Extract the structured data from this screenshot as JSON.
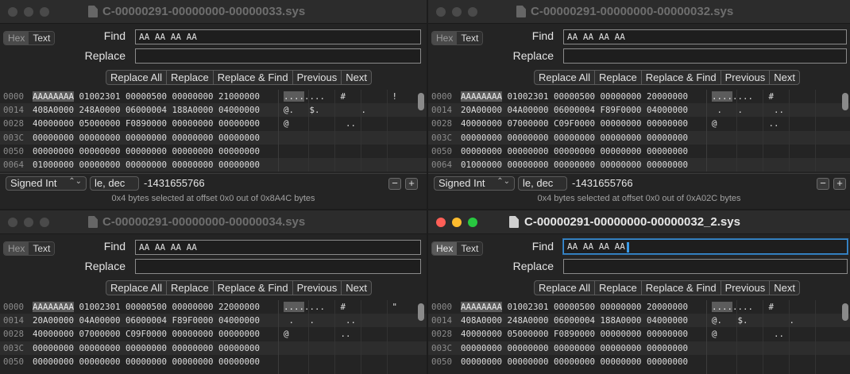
{
  "windows": [
    {
      "title": "C-00000291-00000000-00000033.sys",
      "active": false,
      "hex_label": "Hex",
      "text_label": "Text",
      "find_label": "Find",
      "replace_label": "Replace",
      "find_value": "AA AA AA AA",
      "replace_value": "",
      "buttons": [
        "Replace All",
        "Replace",
        "Replace & Find",
        "Previous",
        "Next"
      ],
      "rows": [
        {
          "offset": "0000",
          "hl": "AAAAAAAA",
          "hex": " 01002301 00000500 00000000 21000000",
          "ascii": "....   #         !"
        },
        {
          "offset": "0014",
          "hl": "",
          "hex": "408A0000 248A0000 06000004 188A0000 04000000",
          "ascii": "@.   $.        ."
        },
        {
          "offset": "0028",
          "hl": "",
          "hex": "40000000 05000000 F0890000 00000000 00000000",
          "ascii": "@           .."
        },
        {
          "offset": "003C",
          "hl": "",
          "hex": "00000000 00000000 00000000 00000000 00000000",
          "ascii": ""
        },
        {
          "offset": "0050",
          "hl": "",
          "hex": "00000000 00000000 00000000 00000000 00000000",
          "ascii": ""
        },
        {
          "offset": "0064",
          "hl": "",
          "hex": "01000000 00000000 00000000 00000000 00000000",
          "ascii": ""
        }
      ],
      "int_type": "Signed Int",
      "endian": "le, dec",
      "value": "-1431655766",
      "status": "0x4 bytes selected at offset 0x0 out of 0x8A4C bytes"
    },
    {
      "title": "C-00000291-00000000-00000032.sys",
      "active": false,
      "hex_label": "Hex",
      "text_label": "Text",
      "find_label": "Find",
      "replace_label": "Replace",
      "find_value": "AA AA AA AA",
      "replace_value": "",
      "buttons": [
        "Replace All",
        "Replace",
        "Replace & Find",
        "Previous",
        "Next"
      ],
      "rows": [
        {
          "offset": "0000",
          "hl": "AAAAAAAA",
          "hex": " 01002301 00000500 00000000 20000000",
          "ascii": "....   #"
        },
        {
          "offset": "0014",
          "hl": "",
          "hex": "20A00000 04A00000 06000004 F89F0000 04000000",
          "ascii": " .   .      .."
        },
        {
          "offset": "0028",
          "hl": "",
          "hex": "40000000 07000000 C09F0000 00000000 00000000",
          "ascii": "@          .."
        },
        {
          "offset": "003C",
          "hl": "",
          "hex": "00000000 00000000 00000000 00000000 00000000",
          "ascii": ""
        },
        {
          "offset": "0050",
          "hl": "",
          "hex": "00000000 00000000 00000000 00000000 00000000",
          "ascii": ""
        },
        {
          "offset": "0064",
          "hl": "",
          "hex": "01000000 00000000 00000000 00000000 00000000",
          "ascii": ""
        }
      ],
      "int_type": "Signed Int",
      "endian": "le, dec",
      "value": "-1431655766",
      "status": "0x4 bytes selected at offset 0x0 out of 0xA02C bytes"
    },
    {
      "title": "C-00000291-00000000-00000034.sys",
      "active": false,
      "hex_label": "Hex",
      "text_label": "Text",
      "find_label": "Find",
      "replace_label": "Replace",
      "find_value": "AA AA AA AA",
      "replace_value": "",
      "buttons": [
        "Replace All",
        "Replace",
        "Replace & Find",
        "Previous",
        "Next"
      ],
      "rows": [
        {
          "offset": "0000",
          "hl": "AAAAAAAA",
          "hex": " 01002301 00000500 00000000 22000000",
          "ascii": "....   #         \""
        },
        {
          "offset": "0014",
          "hl": "",
          "hex": "20A00000 04A00000 06000004 F89F0000 04000000",
          "ascii": " .   .      .."
        },
        {
          "offset": "0028",
          "hl": "",
          "hex": "40000000 07000000 C09F0000 00000000 00000000",
          "ascii": "@          .."
        },
        {
          "offset": "003C",
          "hl": "",
          "hex": "00000000 00000000 00000000 00000000 00000000",
          "ascii": ""
        },
        {
          "offset": "0050",
          "hl": "",
          "hex": "00000000 00000000 00000000 00000000 00000000",
          "ascii": ""
        }
      ]
    },
    {
      "title": "C-00000291-00000000-00000032_2.sys",
      "active": true,
      "hex_label": "Hex",
      "text_label": "Text",
      "find_label": "Find",
      "replace_label": "Replace",
      "find_value": "AA AA AA AA",
      "replace_value": "",
      "buttons": [
        "Replace All",
        "Replace",
        "Replace & Find",
        "Previous",
        "Next"
      ],
      "rows": [
        {
          "offset": "0000",
          "hl": "AAAAAAAA",
          "hex": " 01002301 00000500 00000000 20000000",
          "ascii": "....   #"
        },
        {
          "offset": "0014",
          "hl": "",
          "hex": "408A0000 248A0000 06000004 188A0000 04000000",
          "ascii": "@.   $.        ."
        },
        {
          "offset": "0028",
          "hl": "",
          "hex": "40000000 05000000 F0890000 00000000 00000000",
          "ascii": "@           .."
        },
        {
          "offset": "003C",
          "hl": "",
          "hex": "00000000 00000000 00000000 00000000 00000000",
          "ascii": ""
        },
        {
          "offset": "0050",
          "hl": "",
          "hex": "00000000 00000000 00000000 00000000 00000000",
          "ascii": ""
        }
      ]
    }
  ]
}
